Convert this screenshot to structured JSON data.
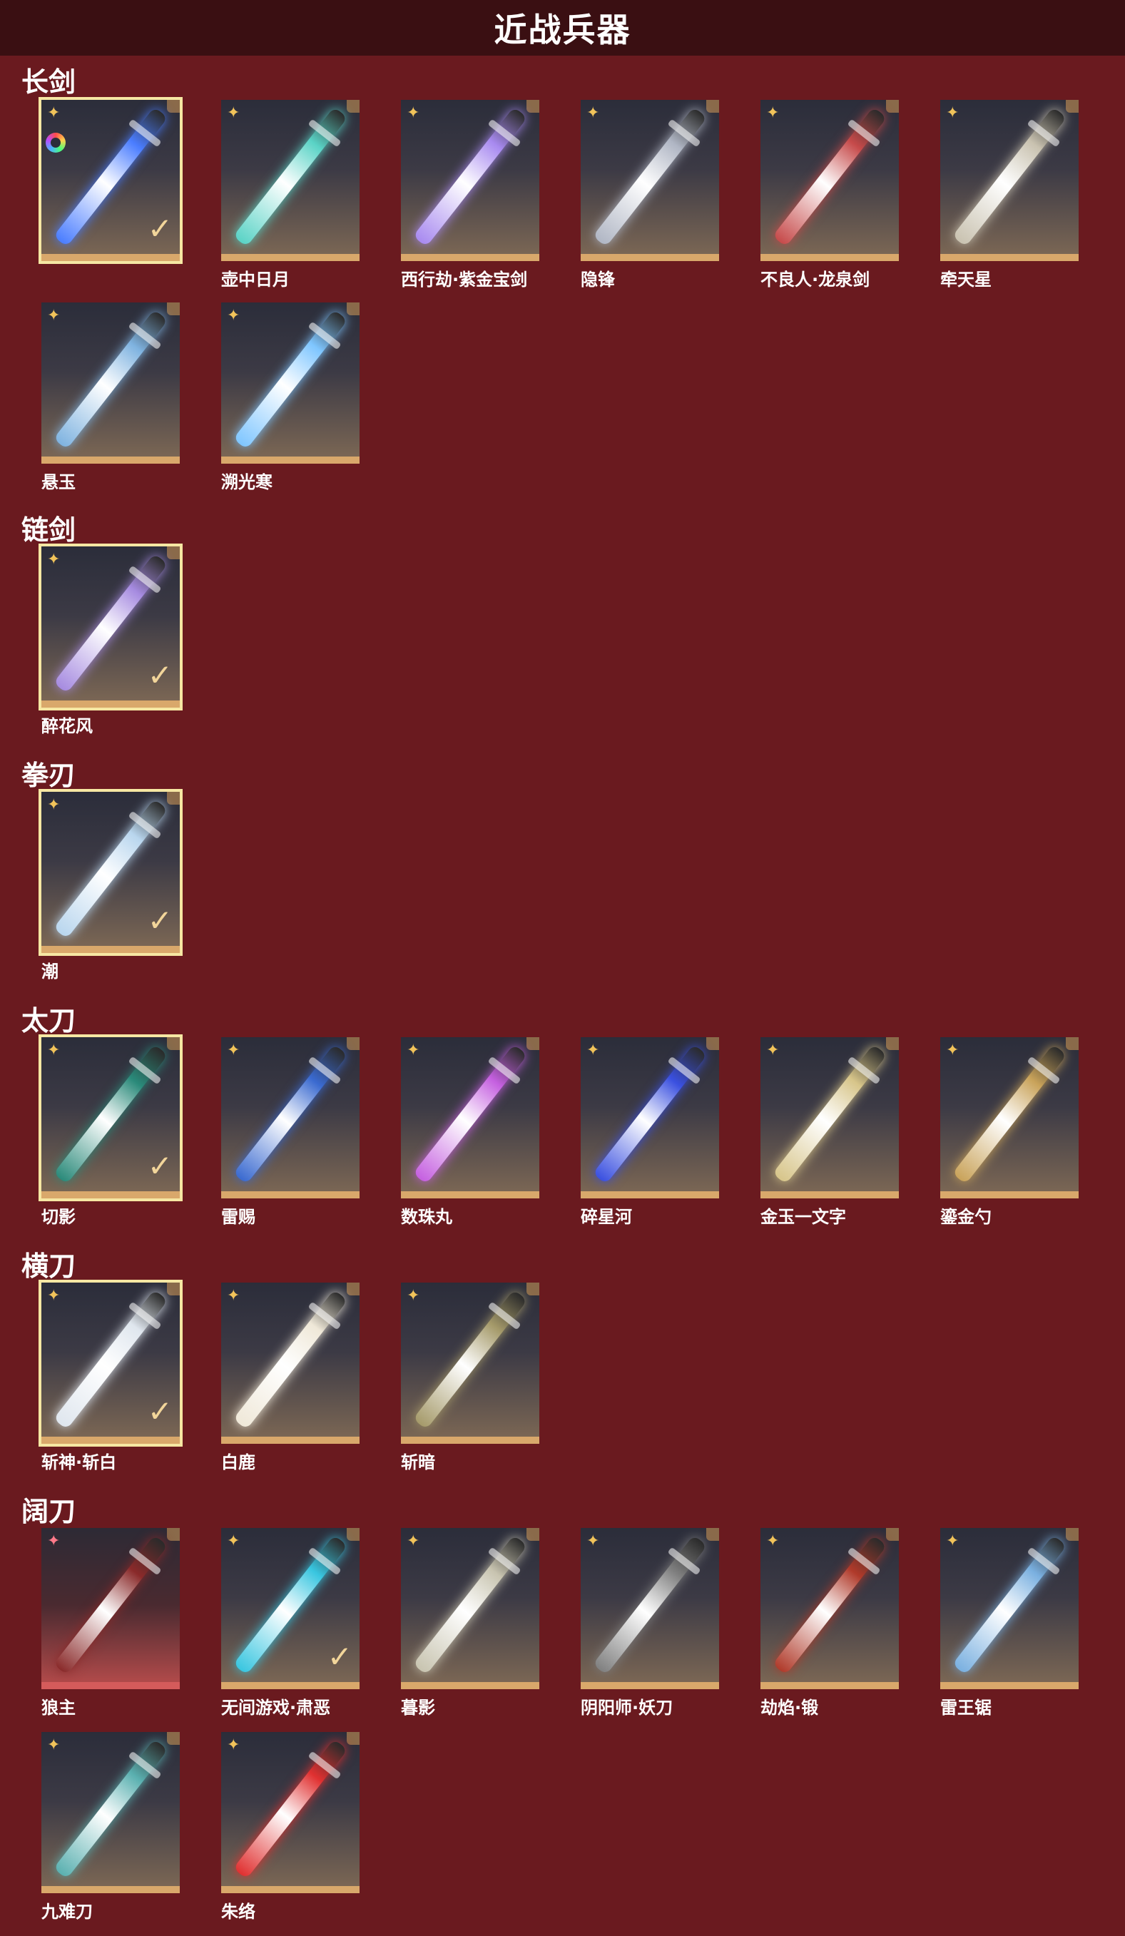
{
  "header": {
    "title": "近战兵器"
  },
  "colors": {
    "background": "#6a1a1f",
    "header_bg": "#3a0f12",
    "rarity_gold": "#f1c35a",
    "rarity_red": "#ff7a8a",
    "selected_outline": "#f6e7a3",
    "card_base_gold": "#d9a86b",
    "card_base_red": "#d55b5b"
  },
  "icons": {
    "star": "✦",
    "check": "✓"
  },
  "sections": [
    {
      "title": "长剑",
      "items": [
        {
          "name": "",
          "selected": true,
          "rarity": "gold",
          "color_icon": true,
          "weapon_color": "#4a7dff"
        },
        {
          "name": "壶中日月",
          "selected": false,
          "rarity": "gold",
          "weapon_color": "#5ad3c6"
        },
        {
          "name": "西行劫·紫金宝剑",
          "selected": false,
          "rarity": "gold",
          "weapon_color": "#a88af0"
        },
        {
          "name": "隐锋",
          "selected": false,
          "rarity": "gold",
          "weapon_color": "#b0b6c4"
        },
        {
          "name": "不良人·龙泉剑",
          "selected": false,
          "rarity": "gold",
          "weapon_color": "#c64a4a"
        },
        {
          "name": "牵天星",
          "selected": false,
          "rarity": "gold",
          "weapon_color": "#c9c2b0"
        },
        {
          "name": "悬玉",
          "selected": false,
          "rarity": "gold",
          "weapon_color": "#7fb3e0"
        },
        {
          "name": "溯光寒",
          "selected": false,
          "rarity": "gold",
          "weapon_color": "#7fc6ff"
        }
      ]
    },
    {
      "title": "链剑",
      "items": [
        {
          "name": "醉花风",
          "selected": true,
          "rarity": "gold",
          "weapon_color": "#a68be0"
        }
      ]
    },
    {
      "title": "拳刃",
      "items": [
        {
          "name": "潮",
          "selected": true,
          "rarity": "gold",
          "weapon_color": "#b9d6ee"
        }
      ]
    },
    {
      "title": "太刀",
      "items": [
        {
          "name": "切影",
          "selected": true,
          "rarity": "gold",
          "weapon_color": "#2a8a7a"
        },
        {
          "name": "雷赐",
          "selected": false,
          "rarity": "gold",
          "weapon_color": "#3a6ad0"
        },
        {
          "name": "数珠丸",
          "selected": false,
          "rarity": "gold",
          "weapon_color": "#c560e0"
        },
        {
          "name": "碎星河",
          "selected": false,
          "rarity": "gold",
          "weapon_color": "#3a50e0"
        },
        {
          "name": "金玉一文字",
          "selected": false,
          "rarity": "gold",
          "weapon_color": "#d7c58a"
        },
        {
          "name": "鎏金勺",
          "selected": false,
          "rarity": "gold",
          "weapon_color": "#c9a35a"
        }
      ]
    },
    {
      "title": "横刀",
      "items": [
        {
          "name": "斩神·斩白",
          "selected": true,
          "rarity": "gold",
          "weapon_color": "#dfe6ee"
        },
        {
          "name": "白鹿",
          "selected": false,
          "rarity": "gold",
          "weapon_color": "#efe8d8"
        },
        {
          "name": "斩暗",
          "selected": false,
          "rarity": "gold",
          "weapon_color": "#a59a6a"
        }
      ]
    },
    {
      "title": "阔刀",
      "items": [
        {
          "name": "狼主",
          "selected": false,
          "rarity": "red",
          "weapon_color": "#8a2a2a"
        },
        {
          "name": "无间游戏·肃恶",
          "selected": false,
          "rarity": "gold",
          "checked": true,
          "weapon_color": "#39c6e0"
        },
        {
          "name": "暮影",
          "selected": false,
          "rarity": "gold",
          "weapon_color": "#c8c4b0"
        },
        {
          "name": "阴阳师·妖刀",
          "selected": false,
          "rarity": "gold",
          "weapon_color": "#808080"
        },
        {
          "name": "劫焰·锻",
          "selected": false,
          "rarity": "gold",
          "weapon_color": "#b03a2a"
        },
        {
          "name": "雷王锯",
          "selected": false,
          "rarity": "gold",
          "weapon_color": "#7ab0e0"
        },
        {
          "name": "九难刀",
          "selected": false,
          "rarity": "gold",
          "weapon_color": "#5ab0b0"
        },
        {
          "name": "朱络",
          "selected": false,
          "rarity": "gold",
          "weapon_color": "#e03030"
        }
      ]
    }
  ]
}
